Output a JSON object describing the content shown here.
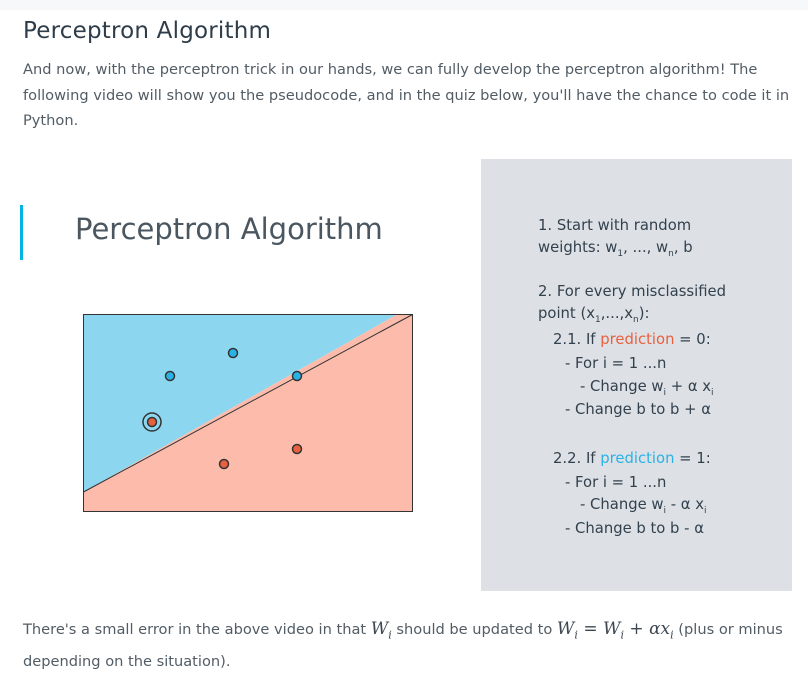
{
  "page": {
    "title": "Perceptron Algorithm",
    "intro": "And now, with the perceptron trick in our hands, we can fully develop the perceptron algorithm! The following video will show you the pseudocode, and in the quiz below, you'll have the chance to code it in Python."
  },
  "video": {
    "title": "Perceptron Algorithm",
    "colors": {
      "positive_region": "#8cd6f0",
      "negative_region": "#fdbcab",
      "blue_point": "#2ab2e6",
      "red_point": "#e8613f",
      "panel": "#dde1e6"
    },
    "pseudocode": {
      "step1_line1": "1. Start with random",
      "step1_line2_a": "weights: w",
      "step1_sub1": "1",
      "step1_line2_b": ", ..., w",
      "step1_subn": "n",
      "step1_line2_c": ", b",
      "step2_line1": "2. For every misclassified",
      "step2_line2_a": "point (x",
      "step2_sub1": "1",
      "step2_line2_b": ",...,x",
      "step2_subn": "n",
      "step2_line2_c": "):",
      "s21_prefix": "2.1. If ",
      "s21_keyword": "prediction",
      "s21_suffix": " = 0:",
      "s21_for": "- For i = 1 ...n",
      "s21_change_a": "- Change w",
      "s21_change_sub1": "i",
      "s21_change_b": " + α x",
      "s21_change_sub2": "i",
      "s21_bias": "- Change b to b + α",
      "s22_prefix": "2.2. If ",
      "s22_keyword": "prediction",
      "s22_suffix": " = 1:",
      "s22_for": "- For i = 1 ...n",
      "s22_change_a": "- Change w",
      "s22_change_sub1": "i",
      "s22_change_b": " - α x",
      "s22_change_sub2": "i",
      "s22_bias": "- Change b to b - α"
    }
  },
  "footnote": {
    "part1": "There's a small error in the above video in that ",
    "w": "W",
    "i": "i",
    "part2": " should be updated to ",
    "eq": "=",
    "plus": "+",
    "alpha": "α",
    "x": "x",
    "part3": " (plus or minus depending on the situation)."
  }
}
